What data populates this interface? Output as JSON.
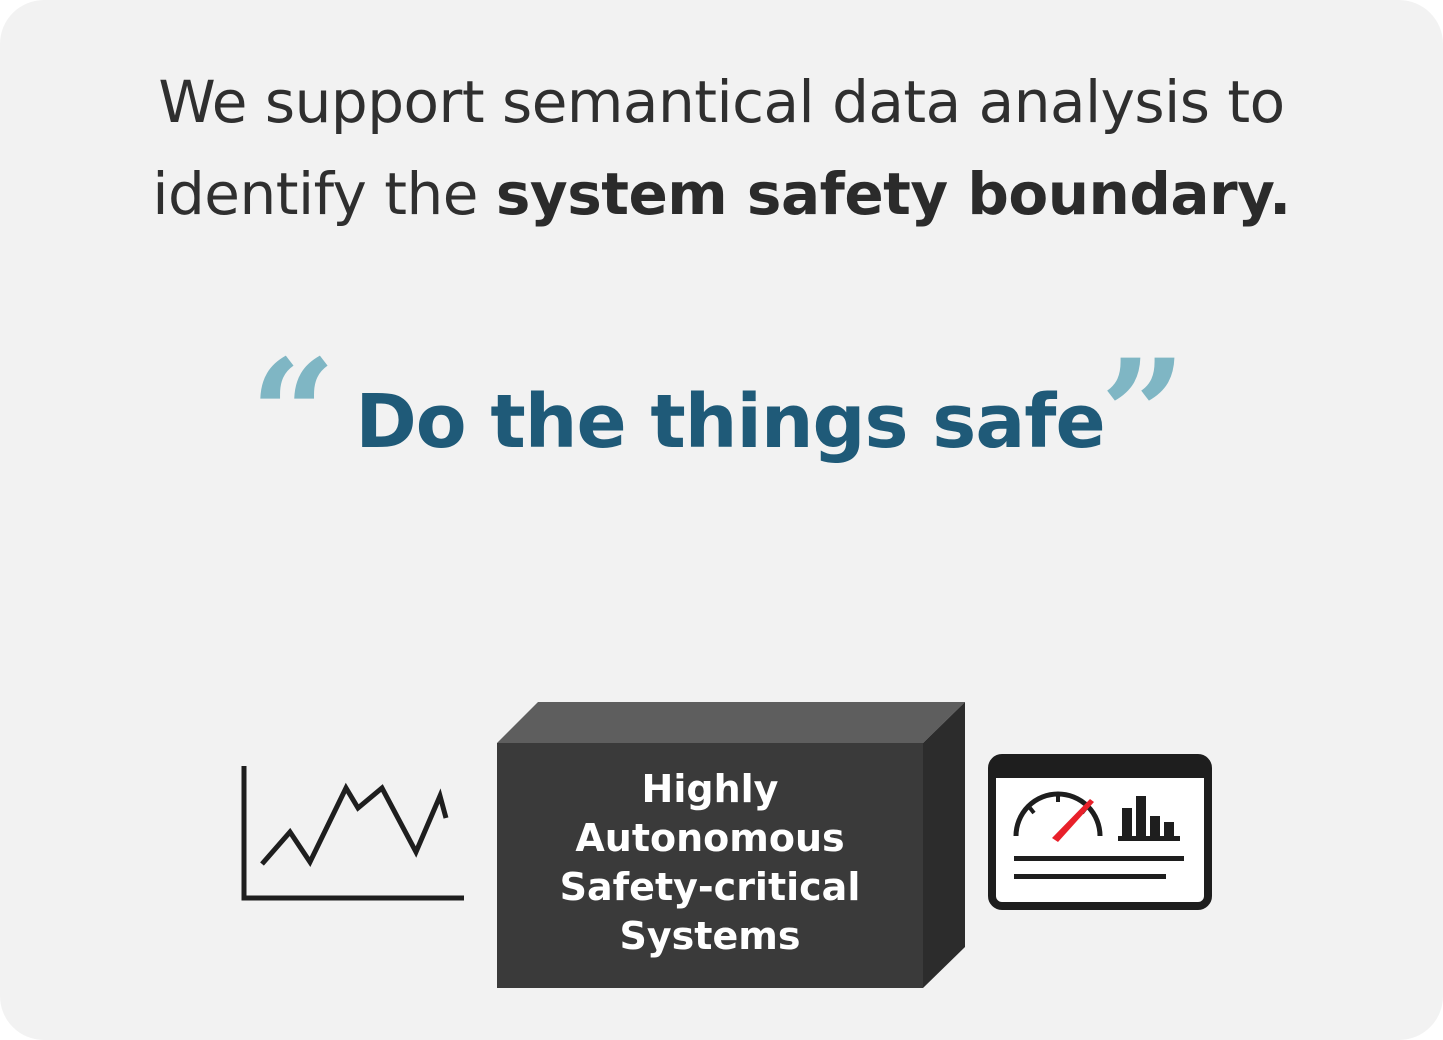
{
  "headline": {
    "line1": "We support semantical data analysis to",
    "line2_prefix": "identify the ",
    "line2_bold": "system safety boundary."
  },
  "motto": {
    "open_quote": "“",
    "text": "Do the things safe",
    "close_quote": "”"
  },
  "system_box": {
    "lines": [
      "Highly",
      "Autonomous",
      "Safety-critical",
      "Systems"
    ]
  },
  "icons": {
    "left": "line-chart-icon",
    "right": "dashboard-gauge-icon"
  },
  "colors": {
    "background": "#f2f2f2",
    "headline_text": "#2f2f2f",
    "motto_text": "#1f5a78",
    "quote_marks": "#7fb6c4",
    "box_front": "#3a3a3a",
    "box_top": "#5e5e5e",
    "box_side": "#2c2c2c",
    "gauge_needle": "#e8202a"
  }
}
